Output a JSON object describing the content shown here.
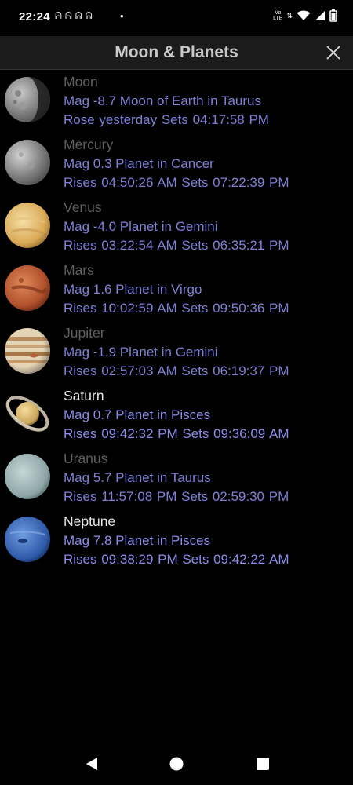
{
  "status_bar": {
    "time": "22:24",
    "notification_icons": "ᕱᕱᕱᕱ",
    "dot": "•",
    "volte_top": "Vo",
    "volte_bottom": "LTE",
    "updown": "⇅"
  },
  "header": {
    "title": "Moon & Planets"
  },
  "objects": [
    {
      "name": "Moon",
      "mag_line": "Mag -8.7 Moon of Earth in Taurus",
      "time_line": "Rose yesterday  Sets 04:17:58 PM",
      "visible": false,
      "icon": "moon-icon"
    },
    {
      "name": "Mercury",
      "mag_line": "Mag 0.3 Planet in Cancer",
      "time_line": "Rises 04:50:26 AM  Sets 07:22:39 PM",
      "visible": false,
      "icon": "mercury-icon"
    },
    {
      "name": "Venus",
      "mag_line": "Mag -4.0 Planet in Gemini",
      "time_line": "Rises 03:22:54 AM  Sets 06:35:21 PM",
      "visible": false,
      "icon": "venus-icon"
    },
    {
      "name": "Mars",
      "mag_line": "Mag 1.6 Planet in Virgo",
      "time_line": "Rises 10:02:59 AM  Sets 09:50:36 PM",
      "visible": false,
      "icon": "mars-icon"
    },
    {
      "name": "Jupiter",
      "mag_line": "Mag -1.9 Planet in Gemini",
      "time_line": "Rises 02:57:03 AM  Sets 06:19:37 PM",
      "visible": false,
      "icon": "jupiter-icon"
    },
    {
      "name": "Saturn",
      "mag_line": "Mag 0.7 Planet in Pisces",
      "time_line": "Rises 09:42:32 PM  Sets 09:36:09 AM",
      "visible": true,
      "icon": "saturn-icon"
    },
    {
      "name": "Uranus",
      "mag_line": "Mag 5.7 Planet in Taurus",
      "time_line": "Rises 11:57:08 PM  Sets 02:59:30 PM",
      "visible": false,
      "icon": "uranus-icon"
    },
    {
      "name": "Neptune",
      "mag_line": "Mag 7.8 Planet in Pisces",
      "time_line": "Rises 09:38:29 PM  Sets 09:42:22 AM",
      "visible": true,
      "icon": "neptune-icon"
    }
  ],
  "colors": {
    "background": "#000000",
    "info_text": "#7e80d6",
    "name_dim": "#5f5f5f",
    "name_visible": "#e6e6e6",
    "title_bar": "#1b1b1b"
  }
}
